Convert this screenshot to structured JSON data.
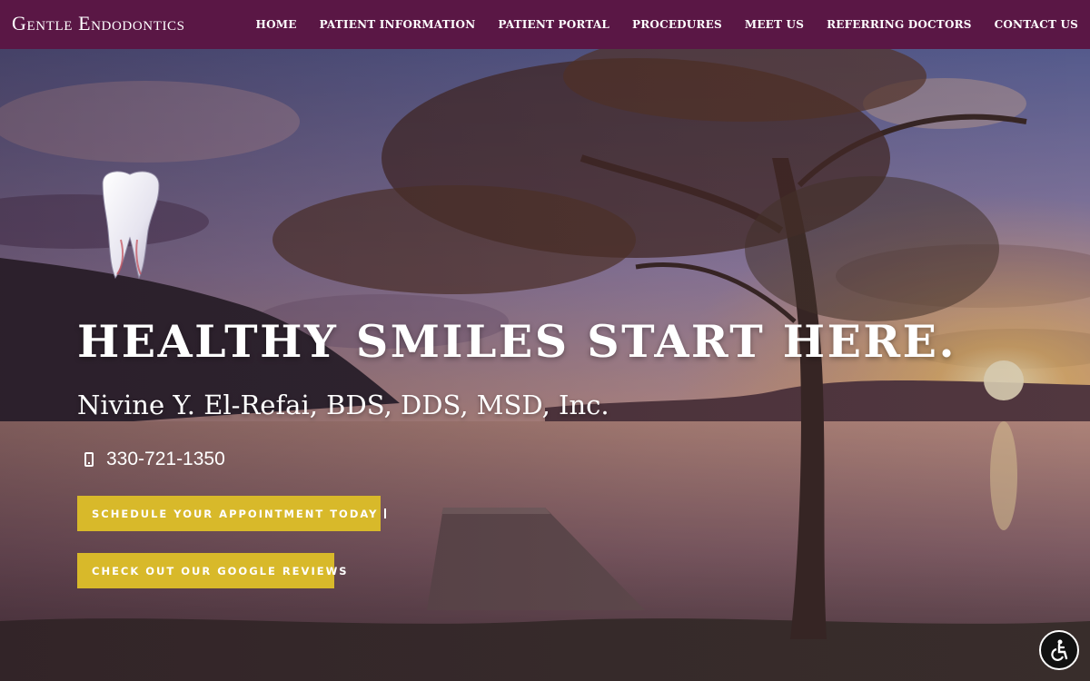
{
  "header": {
    "brand": "Gentle Endodontics",
    "nav": [
      {
        "label": "HOME"
      },
      {
        "label": "PATIENT INFORMATION"
      },
      {
        "label": "PATIENT PORTAL"
      },
      {
        "label": "PROCEDURES"
      },
      {
        "label": "MEET US"
      },
      {
        "label": "REFERRING DOCTORS"
      },
      {
        "label": "CONTACT US"
      }
    ]
  },
  "hero": {
    "headline": "HEALTHY SMILES START HERE.",
    "subheadline": "Nivine Y. El-Refai, BDS, DDS, MSD, Inc.",
    "phone": "330-721-1350",
    "phone_icon": "mobile-phone-icon",
    "schedule_button": "SCHEDULE YOUR APPOINTMENT TODAY",
    "schedule_icon": "calendar-icon",
    "reviews_button": "CHECK OUT OUR GOOGLE REVIEWS",
    "background": "lake-sunset-with-tree-and-dock"
  },
  "accessibility": {
    "icon": "accessibility-icon"
  },
  "colors": {
    "header_bg": "#5a1745",
    "button_bg": "#d8b92a",
    "text": "#ffffff"
  }
}
